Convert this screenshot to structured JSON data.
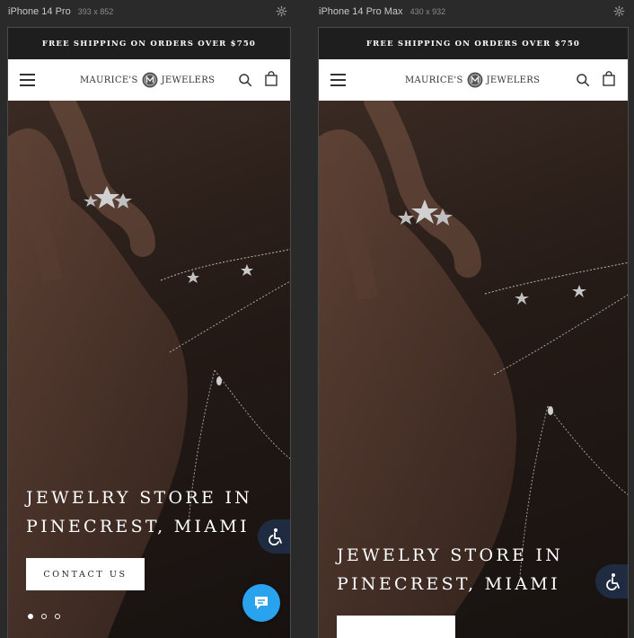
{
  "devices": [
    {
      "name": "iPhone 14 Pro",
      "dims": "393 x 852",
      "promo": "FREE SHIPPING ON ORDERS OVER $750",
      "brand_left": "MAURICE'S",
      "brand_right": "JEWELERS",
      "hero_line1": "JEWELRY STORE IN",
      "hero_line2": "PINECREST, MIAMI",
      "cta": "CONTACT US",
      "slide_count": 3,
      "active_slide": 1
    },
    {
      "name": "iPhone 14 Pro Max",
      "dims": "430 x 932",
      "promo": "FREE SHIPPING ON ORDERS OVER $750",
      "brand_left": "MAURICE'S",
      "brand_right": "JEWELERS",
      "hero_line1": "JEWELRY STORE IN",
      "hero_line2": "PINECREST, MIAMI"
    }
  ],
  "icons": {
    "settings": "gear-icon",
    "menu": "hamburger-menu-icon",
    "search": "search-icon",
    "cart": "shopping-bag-icon",
    "accessibility": "accessibility-icon",
    "chat": "chat-icon"
  },
  "colors": {
    "promo_bar": "#1e1e1e",
    "header": "#ffffff",
    "accessibility_button": "#1f2b40",
    "chat_button": "#2aa3ef",
    "cta_button": "#ffffff"
  }
}
